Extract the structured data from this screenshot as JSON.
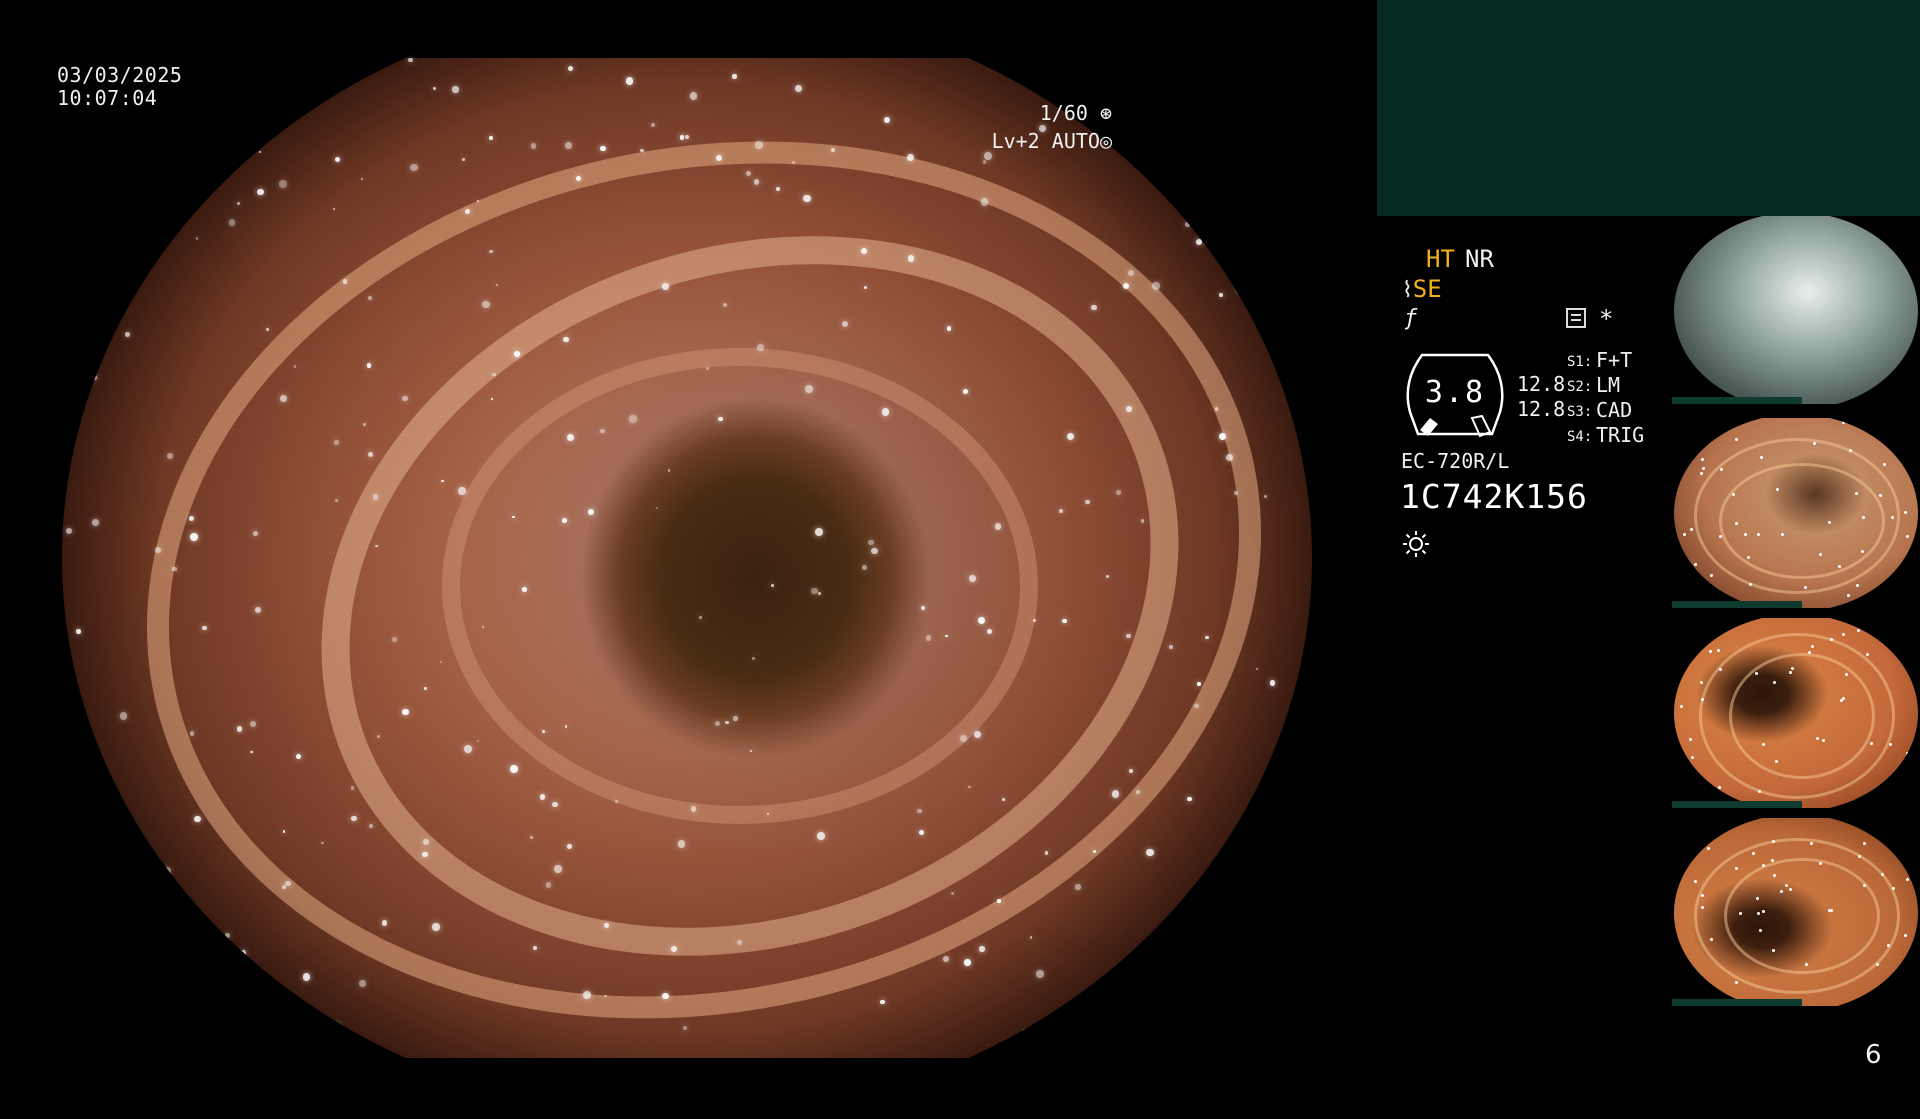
{
  "overlay": {
    "date": "03/03/2025",
    "time": "10:07:04",
    "shutter": "1/60",
    "shutter_icon": "shutter-icon",
    "level": "Lv+2",
    "iris_mode": "AUTO",
    "iris_icon": "iris-icon"
  },
  "modes": {
    "ht": "HT",
    "nr": "NR",
    "se_symbol": "⌇",
    "se": "SE",
    "f_symbol": "ƒ",
    "record_icon": "record-icon",
    "star": "*"
  },
  "gauge": {
    "value": "3.8",
    "right_top": "12.8",
    "right_bottom": "12.8"
  },
  "switches": [
    {
      "label": "S1:",
      "value": "F+T"
    },
    {
      "label": "S2:",
      "value": "LM"
    },
    {
      "label": "S3:",
      "value": "CAD"
    },
    {
      "label": "S4:",
      "value": "TRIG"
    }
  ],
  "scope": {
    "model": "EC-720R/L",
    "serial": "1C742K156",
    "light_icon": "sun-icon"
  },
  "page_number": "6",
  "colors": {
    "mode_active": "#f2b21a",
    "panel_top": "#062a22",
    "thumb_bar": "#0f3a30"
  }
}
